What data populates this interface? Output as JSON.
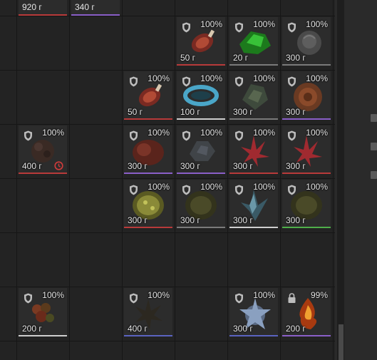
{
  "colors": {
    "red": "#b83a3a",
    "purple": "#8a5fc8",
    "gray": "#7a7a7a",
    "white": "#cfcfcf",
    "green": "#4fae4a",
    "blue": "#5a64c0",
    "warning": "#d03b3b"
  },
  "partials": [
    {
      "price": "920 г",
      "line": "red"
    },
    {
      "price": "340 г",
      "line": "purple"
    }
  ],
  "items": [
    {
      "col": 3,
      "row": 0,
      "pct": "100%",
      "price": "50 г",
      "line": "red",
      "icon": "shield-icon",
      "art": "meat-cut"
    },
    {
      "col": 4,
      "row": 0,
      "pct": "100%",
      "price": "20 г",
      "line": "gray",
      "icon": "shield-icon",
      "art": "green-crystal"
    },
    {
      "col": 5,
      "row": 0,
      "pct": "100%",
      "price": "300 г",
      "line": "gray",
      "icon": "shield-icon",
      "art": "gray-rose"
    },
    {
      "col": 2,
      "row": 1,
      "pct": "100%",
      "price": "50 г",
      "line": "red",
      "icon": "shield-icon",
      "art": "meat-cut"
    },
    {
      "col": 3,
      "row": 1,
      "pct": "100%",
      "price": "100 г",
      "line": "white",
      "icon": "shield-icon",
      "art": "blue-ring"
    },
    {
      "col": 4,
      "row": 1,
      "pct": "100%",
      "price": "300 г",
      "line": "gray",
      "icon": "shield-icon",
      "art": "green-leaf"
    },
    {
      "col": 5,
      "row": 1,
      "pct": "100%",
      "price": "300 г",
      "line": "purple",
      "icon": "shield-icon",
      "art": "brown-spiral"
    },
    {
      "col": 0,
      "row": 2,
      "pct": "100%",
      "price": "400 г",
      "line": "red",
      "icon": "shield-icon",
      "art": "dark-berry",
      "warning": true
    },
    {
      "col": 2,
      "row": 2,
      "pct": "100%",
      "price": "300 г",
      "line": "purple",
      "icon": "shield-icon",
      "art": "red-shell"
    },
    {
      "col": 3,
      "row": 2,
      "pct": "100%",
      "price": "300 г",
      "line": "purple",
      "icon": "shield-icon",
      "art": "gray-petals"
    },
    {
      "col": 4,
      "row": 2,
      "pct": "100%",
      "price": "300 г",
      "line": "red",
      "icon": "shield-icon",
      "art": "red-spikes"
    },
    {
      "col": 5,
      "row": 2,
      "pct": "100%",
      "price": "300 г",
      "line": "red",
      "icon": "shield-icon",
      "art": "red-spikes"
    },
    {
      "col": 2,
      "row": 3,
      "pct": "100%",
      "price": "300 г",
      "line": "red",
      "icon": "shield-icon",
      "art": "yellow-barrel"
    },
    {
      "col": 3,
      "row": 3,
      "pct": "100%",
      "price": "300 г",
      "line": "gray",
      "icon": "shield-icon",
      "art": "dark-barrel"
    },
    {
      "col": 4,
      "row": 3,
      "pct": "100%",
      "price": "300 г",
      "line": "white",
      "icon": "shield-icon",
      "art": "ice-shard"
    },
    {
      "col": 5,
      "row": 3,
      "pct": "100%",
      "price": "300 г",
      "line": "green",
      "icon": "shield-icon",
      "art": "dark-barrel"
    },
    {
      "col": 0,
      "row": 5,
      "pct": "100%",
      "price": "200 г",
      "line": "white",
      "icon": "shield-icon",
      "art": "berry-cluster"
    },
    {
      "col": 2,
      "row": 5,
      "pct": "100%",
      "price": "400 г",
      "line": "blue",
      "icon": "shield-icon",
      "art": "dark-spikes"
    },
    {
      "col": 4,
      "row": 5,
      "pct": "100%",
      "price": "300 г",
      "line": "blue",
      "icon": "shield-icon",
      "art": "blue-spore"
    },
    {
      "col": 5,
      "row": 5,
      "pct": "99%",
      "price": "200 г",
      "line": "purple",
      "icon": "lock-icon",
      "art": "amber-flame"
    }
  ]
}
